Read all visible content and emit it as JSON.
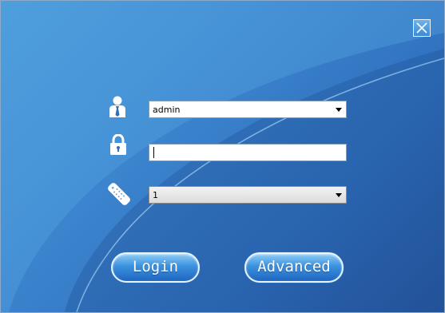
{
  "user_row": {
    "icon": "user-icon",
    "selected_user": "admin"
  },
  "password_row": {
    "icon": "lock-icon",
    "value": ""
  },
  "channel_row": {
    "icon": "remote-control-icon",
    "selected_value": "1"
  },
  "buttons": {
    "login_label": "Login",
    "advanced_label": "Advanced"
  },
  "window": {
    "close_icon": "close-icon"
  },
  "colors": {
    "background_light": "#4a9ad8",
    "background_dark": "#24539a",
    "button_gradient_top": "#8fcdf6",
    "button_gradient_bottom": "#1f66c0"
  }
}
